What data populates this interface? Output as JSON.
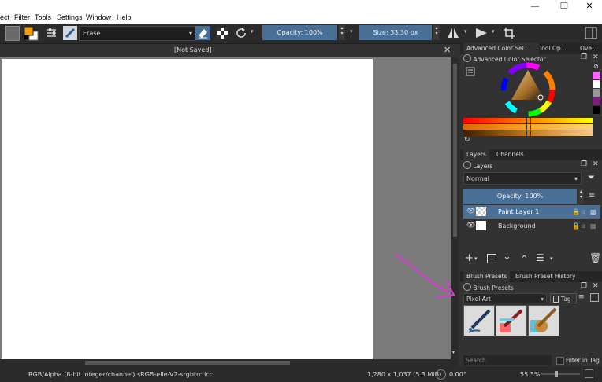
{
  "menu": [
    "ect",
    "Filter",
    "Tools",
    "Settings",
    "Window",
    "Help"
  ],
  "window_controls": {
    "minimize": "—",
    "restore": "❐",
    "close": "✕"
  },
  "toolbar": {
    "blend_mode": "Erase",
    "opacity_label": "Opacity: 100%",
    "size_label": "Size: 33.30 px"
  },
  "canvas": {
    "title": "[Not Saved]",
    "close": "✕"
  },
  "status": {
    "color_profile": "RGB/Alpha (8-bit integer/channel)  sRGB-elle-V2-srgbtrc.icc",
    "dimensions": "1,280 x 1,037 (5.3 MiB)",
    "rotation": "0.00°",
    "zoom": "55.3%"
  },
  "docker_tabs": [
    "Advanced Color Sel...",
    "Tool Op...",
    "Ove..."
  ],
  "color_selector": {
    "title": "Advanced Color Selector"
  },
  "layers_tabs": [
    "Layers",
    "Channels"
  ],
  "layers": {
    "title": "Layers",
    "blend_mode": "Normal",
    "opacity_label": "Opacity:  100%",
    "items": [
      {
        "name": "Paint Layer 1",
        "selected": true
      },
      {
        "name": "Background",
        "selected": false
      }
    ]
  },
  "brush_tabs": [
    "Brush Presets",
    "Brush Preset History"
  ],
  "brush_presets": {
    "title": "Brush Presets",
    "tag_filter": "Pixel Art",
    "tag_label": "Tag",
    "search_placeholder": "Search",
    "filter_in_tag": "Filter in Tag"
  },
  "colors": {
    "accent": "#4a6f96",
    "selection": "#4a6f96",
    "annotation_arrow": "#d63bd0"
  }
}
